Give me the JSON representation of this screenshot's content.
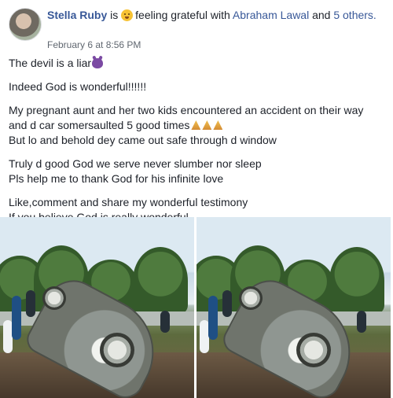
{
  "post": {
    "author": "Stella Ruby",
    "header_is": "is",
    "feeling_icon": "happy-face-icon",
    "feeling_text": "feeling grateful with",
    "tagged_person": "Abraham Lawal",
    "header_and": "and",
    "others_text": "5 others.",
    "timestamp": "February 6 at 8:56 PM",
    "body": {
      "line1": "The devil is a liar",
      "line2": "Indeed God is wonderful!!!!!!",
      "line3": "My pregnant aunt and her two kids encountered an accident on their way",
      "line4": "and d car somersaulted 5 good times",
      "line5": "But lo and behold dey came out safe through d window",
      "line6": "Truly d good God we serve never slumber nor sleep",
      "line7": "Pls help me to thank God for his infinite love",
      "line8": "Like,comment and share my wonderful testimony",
      "line9": "If you believe God is really wonderful"
    },
    "body_icons": {
      "devil": "devil-emoji-icon",
      "pray": "praying-hands-emoji-icon"
    },
    "photos": [
      {
        "type": "accident-photo"
      },
      {
        "type": "accident-photo"
      }
    ]
  },
  "colors": {
    "link": "#385898",
    "text": "#1d2129",
    "secondary": "#606770"
  }
}
